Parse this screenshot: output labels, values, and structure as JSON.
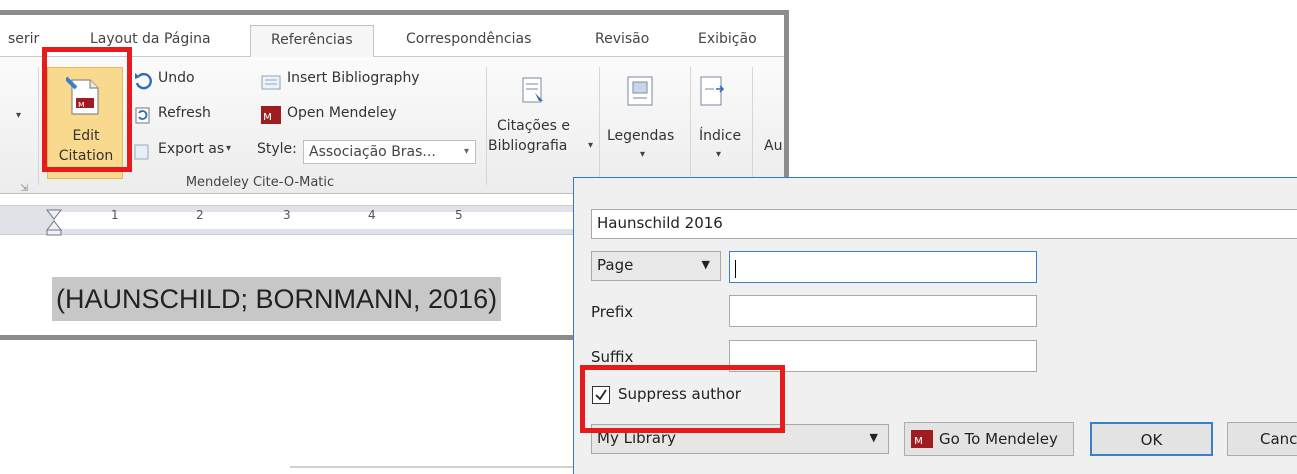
{
  "word": {
    "tabs": [
      {
        "label": "serir"
      },
      {
        "label": "Layout da Página"
      },
      {
        "label": "Referências",
        "active": true
      },
      {
        "label": "Correspondências"
      },
      {
        "label": "Revisão"
      },
      {
        "label": "Exibição"
      }
    ],
    "mendeley": {
      "edit_line1": "Edit",
      "edit_line2": "Citation",
      "undo": "Undo",
      "refresh": "Refresh",
      "export_as": "Export as",
      "insert_bibliography": "Insert Bibliography",
      "open_mendeley": "Open Mendeley",
      "style_label": "Style:",
      "style_value": "Associação Bras...",
      "group_label": "Mendeley Cite-O-Matic"
    },
    "citacoes_line1": "Citações e",
    "citacoes_line2": "Bibliografia",
    "legendas": "Legendas",
    "indice": "Índice",
    "partial_label": "Au",
    "ruler_numbers": [
      "1",
      "2",
      "3",
      "4",
      "5"
    ],
    "document_text": "(HAUNSCHILD; BORNMANN, 2016)"
  },
  "dialog": {
    "search_value": "Haunschild 2016",
    "locator_type": "Page",
    "locator_value": "",
    "prefix_label": "Prefix",
    "prefix_value": "",
    "suffix_label": "Suffix",
    "suffix_value": "",
    "suppress_author_label": "Suppress author",
    "suppress_author_checked": true,
    "library_value": "My Library",
    "go_to_mendeley": "Go To Mendeley",
    "ok": "OK",
    "cancel_partial": "Canc"
  },
  "colors": {
    "highlight_red": "#e61c1c",
    "mendeley_red": "#9f1d20",
    "edit_button_bg": "#f9d98d",
    "dialog_border": "#2d7bc9"
  }
}
